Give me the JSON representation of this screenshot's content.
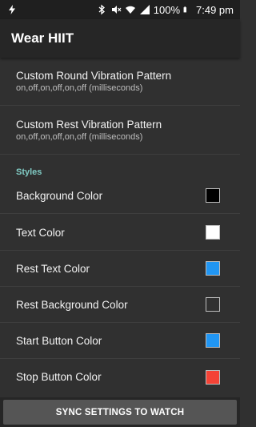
{
  "status_bar": {
    "battery_percent": "100%",
    "time": "7:49 pm",
    "icons": [
      "flash-icon",
      "bluetooth-icon",
      "mute-icon",
      "wifi-icon",
      "signal-icon",
      "battery-icon"
    ]
  },
  "app_bar": {
    "title": "Wear HIIT"
  },
  "preferences": [
    {
      "title": "Custom Round Vibration Pattern",
      "summary": "on,off,on,off,on,off (milliseconds)"
    },
    {
      "title": "Custom Rest Vibration Pattern",
      "summary": "on,off,on,off,on,off (milliseconds)"
    }
  ],
  "styles_section": {
    "header": "Styles",
    "items": [
      {
        "label": "Background Color",
        "color": "#000000"
      },
      {
        "label": "Text Color",
        "color": "#ffffff"
      },
      {
        "label": "Rest Text Color",
        "color": "#2196f3"
      },
      {
        "label": "Rest Background Color",
        "color": "#303030"
      },
      {
        "label": "Start Button Color",
        "color": "#2196f3"
      },
      {
        "label": "Stop Button Color",
        "color": "#f44336"
      }
    ]
  },
  "sync_button": {
    "label": "SYNC SETTINGS TO WATCH"
  }
}
